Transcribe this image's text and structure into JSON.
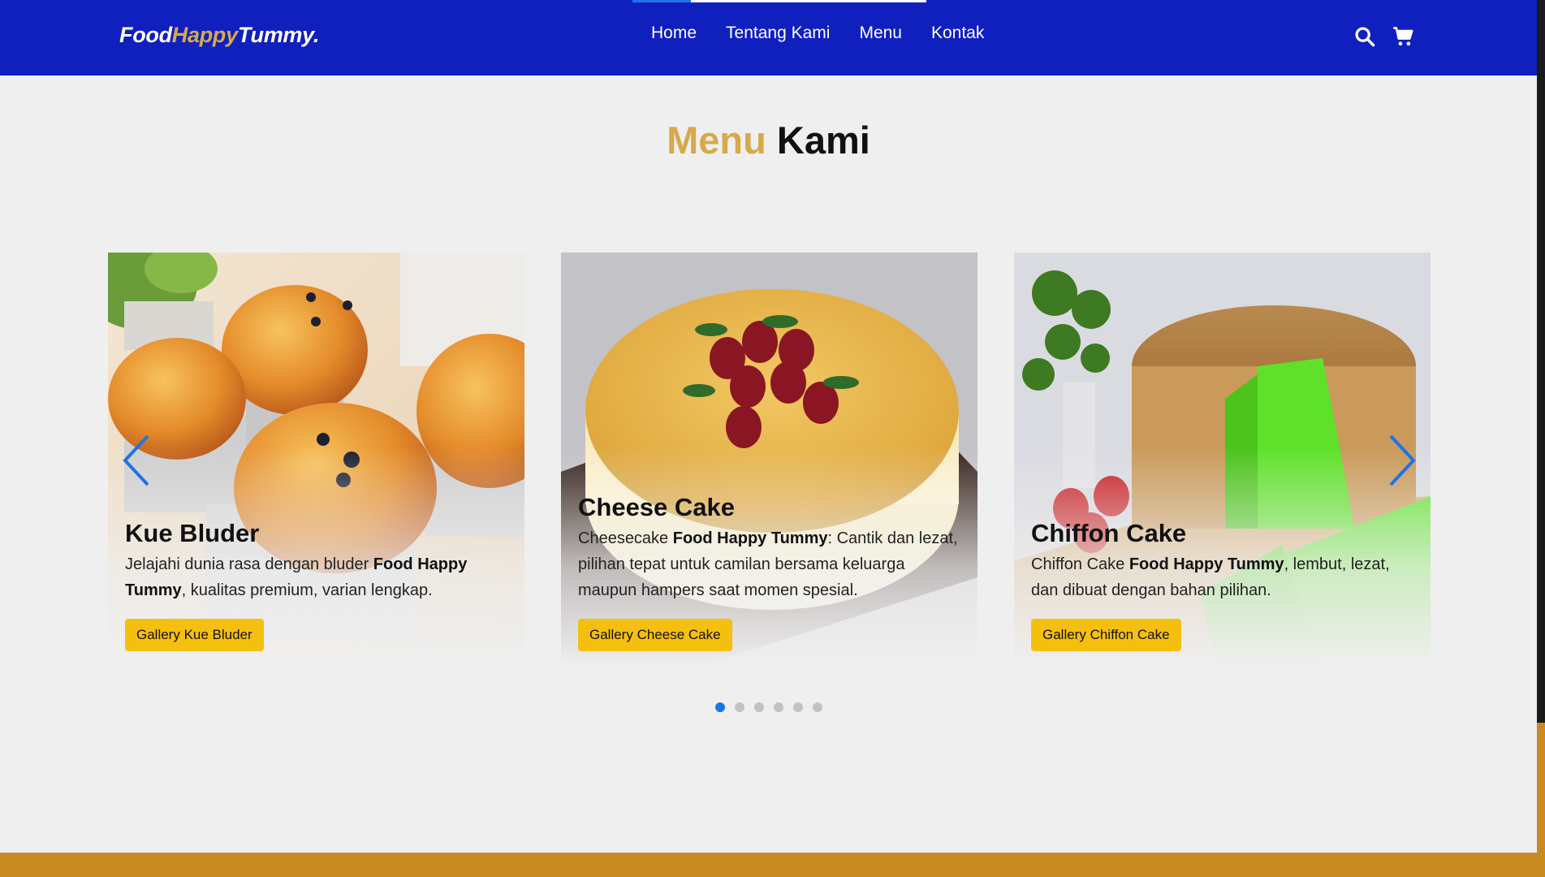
{
  "header": {
    "logo": {
      "part1": "Food",
      "part2": "Happy",
      "part3": "Tummy."
    },
    "nav": [
      {
        "label": "Home"
      },
      {
        "label": "Tentang Kami"
      },
      {
        "label": "Menu"
      },
      {
        "label": "Kontak"
      }
    ],
    "icons": [
      "search-icon",
      "cart-icon"
    ],
    "scroll_progress": 0.2
  },
  "section": {
    "title_accent": "Menu",
    "title_rest": "Kami"
  },
  "carousel": {
    "cards": [
      {
        "title": "Kue Bluder",
        "desc_before": "Jelajahi dunia rasa dengan bluder ",
        "desc_bold": "Food Happy Tummy",
        "desc_after": ", kualitas premium, varian lengkap.",
        "button": "Gallery Kue Bluder"
      },
      {
        "title": "Cheese Cake",
        "desc_before": "Cheesecake ",
        "desc_bold": "Food Happy Tummy",
        "desc_after": ": Cantik dan lezat, pilihan tepat untuk camilan bersama keluarga maupun hampers saat momen spesial.",
        "button": "Gallery Cheese Cake"
      },
      {
        "title": "Chiffon Cake",
        "desc_before": "Chiffon Cake ",
        "desc_bold": "Food Happy Tummy",
        "desc_after": ", lembut, lezat, dan dibuat dengan bahan pilihan.",
        "button": "Gallery Chiffon Cake"
      }
    ],
    "dots_total": 6,
    "active_dot": 1
  },
  "colors": {
    "nav_bg": "#1020bf",
    "accent_gold": "#d6aa4a",
    "button_yellow": "#f5bf10",
    "arrow_blue": "#1e73e8",
    "footer": "#c98a20"
  }
}
